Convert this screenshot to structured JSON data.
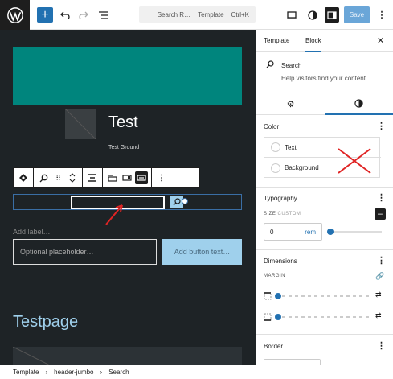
{
  "topbar": {
    "search_label": "Search R…",
    "template_label": "Template",
    "shortcut": "Ctrl+K",
    "save_label": "Save"
  },
  "canvas": {
    "title": "Test",
    "subtitle": "Test Ground",
    "add_label": "Add label…",
    "placeholder": "Optional placeholder…",
    "button_text": "Add button text…",
    "page_title": "Testpage"
  },
  "breadcrumb": {
    "items": [
      "Template",
      "header-jumbo",
      "Search"
    ],
    "separator": "›"
  },
  "sidebar": {
    "tabs": [
      "Template",
      "Block"
    ],
    "active_tab": "Block",
    "block_name": "Search",
    "block_description": "Help visitors find your content.",
    "color": {
      "title": "Color",
      "items": [
        "Text",
        "Background"
      ]
    },
    "typography": {
      "title": "Typography",
      "size_label": "SIZE",
      "size_sublabel": "CUSTOM",
      "size_value": "0",
      "size_unit": "rem"
    },
    "dimensions": {
      "title": "Dimensions",
      "margin_label": "MARGIN"
    },
    "border": {
      "title": "Border"
    }
  },
  "colors": {
    "accent": "#2271b1",
    "banner": "#00857d",
    "canvas_bg": "#1e2326",
    "button_light": "#9fd0ec",
    "annotation_red": "#e02424"
  }
}
